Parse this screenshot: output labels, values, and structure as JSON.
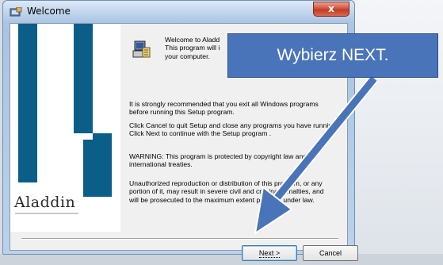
{
  "window": {
    "title": "Welcome",
    "close_label": "x"
  },
  "content": {
    "welcome_lines": [
      "Welcome to Aladd",
      "This program will i",
      "your computer."
    ],
    "paragraph1": "It is strongly recommended that you exit all Windows programs before running this Setup program.",
    "paragraph2": "Click Cancel to quit Setup and close any programs you have running.  Click Next to continue with the Setup program .",
    "paragraph3": "WARNING: This program is protected by copyright law and international treaties.",
    "paragraph4": "Unauthorized reproduction or distribution of this program, or any portion of it, may result in severe civil and criminal penalties, and will be prosecuted to the maximum extent possible under law."
  },
  "brand": {
    "logo_text": "Aladdin",
    "bar_color": "#0b5e87"
  },
  "buttons": {
    "next_label": "Next >",
    "cancel_label": "Cancel"
  },
  "annotation": {
    "callout_text": "Wybierz NEXT.",
    "callout_color": "#4a74b9",
    "arrow_color": "#4a74b9"
  },
  "icons": {
    "title_icon": "setup-window-icon",
    "setup_icon": "computer-install-icon"
  }
}
